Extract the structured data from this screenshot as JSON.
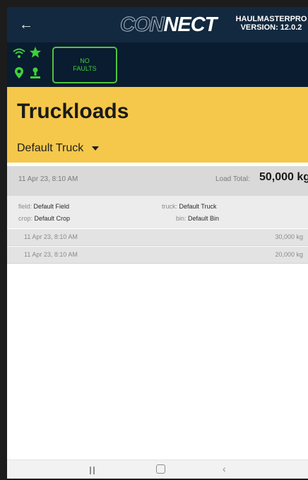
{
  "header": {
    "logo_left": "CON",
    "logo_right": "NECT",
    "version_line1": "HAULMASTERPRO",
    "version_line2": "VERSION: 12.0.2"
  },
  "status": {
    "faults_line1": "NO",
    "faults_line2": "FAULTS",
    "icon_color": "#3ed13a"
  },
  "page": {
    "title": "Truckloads",
    "truck_selected": "Default Truck"
  },
  "load": {
    "date": "11 Apr 23, 8:10 AM",
    "total_label": "Load Total:",
    "total_value": "50,000 kg",
    "field_label": "field:",
    "field_value": "Default Field",
    "crop_label": "crop:",
    "crop_value": "Default Crop",
    "truck_label": "truck:",
    "truck_value": "Default Truck",
    "bin_label": "bin:",
    "bin_value": "Default Bin",
    "entries": [
      {
        "date": "11 Apr 23, 8:10 AM",
        "weight": "30,000 kg"
      },
      {
        "date": "11 Apr 23, 8:10 AM",
        "weight": "20,000 kg"
      }
    ]
  },
  "colors": {
    "header_bg": "#13293f",
    "status_bg": "#0a1c30",
    "accent_yellow": "#f5c84b",
    "ok_green": "#3ed13a"
  }
}
